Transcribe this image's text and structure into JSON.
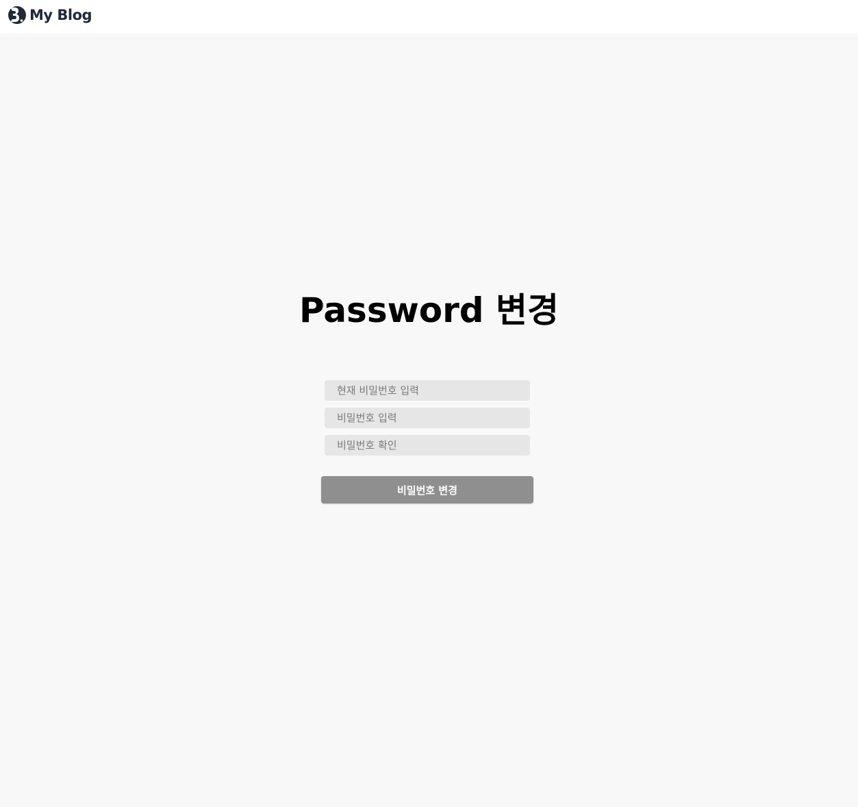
{
  "header": {
    "logo_text": "My Blog",
    "logo_icon": "blog-logo-icon"
  },
  "main": {
    "title": "Password 변경",
    "fields": {
      "current_password_placeholder": "현재 비밀번호 입력",
      "new_password_placeholder": "비밀번호 입력",
      "confirm_password_placeholder": "비밀번호 확인"
    },
    "submit_label": "비밀번호 변경"
  },
  "colors": {
    "page_background": "#f8f8f8",
    "header_background": "#ffffff",
    "input_background": "#e6e6e6",
    "button_background": "#8f8f8f",
    "logo_color": "#1f2937"
  }
}
